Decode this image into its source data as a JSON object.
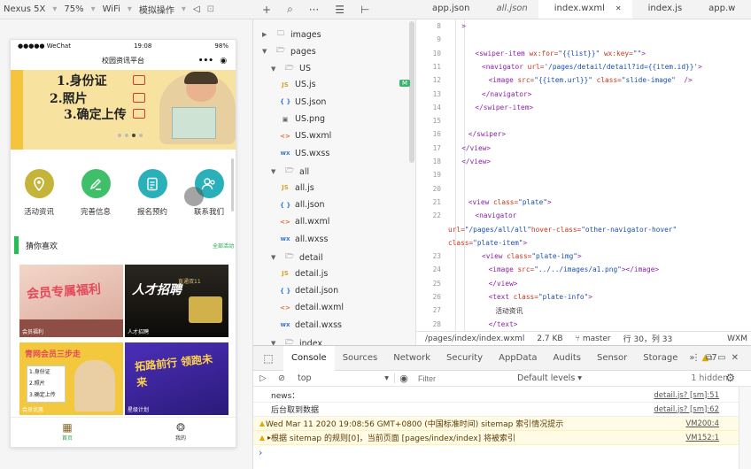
{
  "simulator": {
    "device": "Nexus 5X",
    "zoom": "75%",
    "network": "WiFi",
    "operation": "模拟操作",
    "status": {
      "carrier": "●●●●● WeChat",
      "wifi_glyph": "ᯤ",
      "time": "19:08",
      "battery": "98%"
    },
    "nav_title": "校园资讯平台",
    "capsule_more": "•••",
    "banner_lines": [
      "1.身份证",
      "2.照片",
      "3.确定上传"
    ],
    "banner_dots": 4,
    "banner_active_dot": 3,
    "menu": [
      {
        "label": "活动资讯",
        "icon": "location-icon",
        "color": "#c5b43a"
      },
      {
        "label": "完善信息",
        "icon": "edit-icon",
        "color": "#3fbf6a"
      },
      {
        "label": "报名预约",
        "icon": "document-icon",
        "color": "#29b0b8"
      },
      {
        "label": "联系我们",
        "icon": "contacts-icon",
        "color": "#29b0b8"
      }
    ],
    "guess_title": "猜你喜欢",
    "guess_more": "全部活动",
    "cards": [
      {
        "caption": "会员福利",
        "headline": "会员专属福利"
      },
      {
        "caption": "人才招聘",
        "headline": "人才招聘"
      },
      {
        "caption": "会员优惠",
        "headline": "青网会员三步走"
      },
      {
        "caption": "星级计划",
        "headline": "拓路前行 领跑未来"
      }
    ],
    "card2_sub": "直通双11",
    "card3_lines": [
      "1.身份证",
      "2.照片",
      "3.确定上传"
    ],
    "tabs": [
      {
        "label": "首页",
        "active": true
      },
      {
        "label": "我的",
        "active": false
      }
    ]
  },
  "ide": {
    "tree": [
      {
        "label": "images",
        "type": "folder",
        "open": false
      },
      {
        "label": "pages",
        "type": "folder",
        "open": true
      },
      {
        "label": "US",
        "type": "folder",
        "open": true
      },
      {
        "label": "US.js",
        "type": "js",
        "badge": "M"
      },
      {
        "label": "US.json",
        "type": "json"
      },
      {
        "label": "US.png",
        "type": "png"
      },
      {
        "label": "US.wxml",
        "type": "wxml"
      },
      {
        "label": "US.wxss",
        "type": "wxss"
      },
      {
        "label": "all",
        "type": "folder",
        "open": true
      },
      {
        "label": "all.js",
        "type": "js"
      },
      {
        "label": "all.json",
        "type": "json"
      },
      {
        "label": "all.wxml",
        "type": "wxml"
      },
      {
        "label": "all.wxss",
        "type": "wxss"
      },
      {
        "label": "detail",
        "type": "folder",
        "open": true
      },
      {
        "label": "detail.js",
        "type": "js"
      },
      {
        "label": "detail.json",
        "type": "json"
      },
      {
        "label": "detail.wxml",
        "type": "wxml"
      },
      {
        "label": "detail.wxss",
        "type": "wxss"
      },
      {
        "label": "index",
        "type": "folder",
        "open": true
      }
    ],
    "tabs": [
      {
        "label": "app.json",
        "active": false,
        "italic": false
      },
      {
        "label": "all.json",
        "active": false,
        "italic": true
      },
      {
        "label": "index.wxml",
        "active": true,
        "italic": false,
        "close": "✕"
      },
      {
        "label": "index.js",
        "active": false,
        "italic": false
      },
      {
        "label": "app.w",
        "active": false,
        "italic": false
      }
    ],
    "code": [
      {
        "n": "8",
        "text": ">"
      },
      {
        "n": "9",
        "text": ""
      },
      {
        "n": "10",
        "text": "<swiper-item wx:for=\"{{list}}\" wx:key=\"\">"
      },
      {
        "n": "11",
        "text": "<navigator url='/pages/detail/detail?id={{item.id}}'>"
      },
      {
        "n": "12",
        "text": "<image src=\"{{item.url}}\" class=\"slide-image\"  />"
      },
      {
        "n": "13",
        "text": "</navigator>"
      },
      {
        "n": "14",
        "text": "</swiper-item>"
      },
      {
        "n": "15",
        "text": ""
      },
      {
        "n": "16",
        "text": "</swiper>"
      },
      {
        "n": "17",
        "text": "</view>"
      },
      {
        "n": "18",
        "text": "</view>"
      },
      {
        "n": "19",
        "text": ""
      },
      {
        "n": "20",
        "text": ""
      },
      {
        "n": "21",
        "text": "<view class=\"plate\">"
      },
      {
        "n": "22",
        "text": "<navigator"
      },
      {
        "n": "",
        "text": "url=\"/pages/all/all\"hover-class=\"other-navigator-hover\""
      },
      {
        "n": "",
        "text": "class=\"plate-item\">"
      },
      {
        "n": "23",
        "text": "<view class=\"plate-img\">"
      },
      {
        "n": "24",
        "text": "<image src=\"../../images/a1.png\"></image>"
      },
      {
        "n": "25",
        "text": "</view>"
      },
      {
        "n": "26",
        "text": "<text class=\"plate-info\">"
      },
      {
        "n": "27",
        "text": "活动资讯"
      },
      {
        "n": "28",
        "text": "</text>"
      },
      {
        "n": "29",
        "text": ""
      }
    ],
    "status_path": "/pages/index/index.wxml",
    "status_size": "2.7 KB",
    "status_branch": "master",
    "status_pos": "行 30，列 33",
    "status_right": "WXM"
  },
  "console": {
    "tabs": [
      "Console",
      "Sources",
      "Network",
      "Security",
      "AppData",
      "Audits",
      "Sensor",
      "Storage"
    ],
    "warn_count": "7",
    "context": "top",
    "filter_placeholder": "Filter",
    "levels": "Default levels",
    "hidden": "1 hidden",
    "messages": [
      {
        "text": "news：",
        "src": "detail.js? [sm]:51",
        "type": "log"
      },
      {
        "text": "后台取到数据",
        "src": "detail.js? [sm]:62",
        "type": "log"
      },
      {
        "text": "Wed Mar 11 2020 19:08:56 GMT+0800 (中国标准时间) sitemap 索引情况提示",
        "src": "VM200:4",
        "type": "warn-header"
      },
      {
        "text": "根据 sitemap 的规则[0]，当前页面 [pages/index/index] 将被索引",
        "src": "VM152:1",
        "type": "warn"
      }
    ],
    "prompt": "›"
  }
}
